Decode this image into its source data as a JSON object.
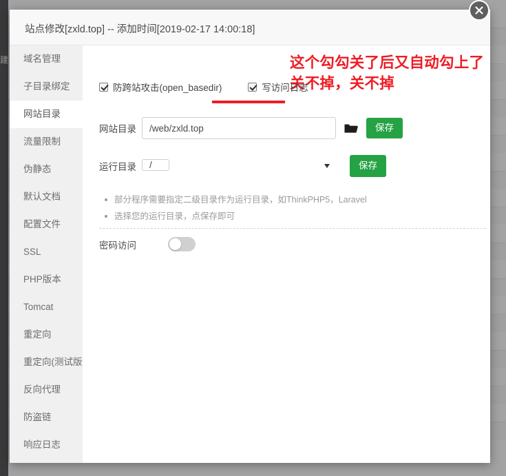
{
  "background": {
    "rail_label": "建"
  },
  "modal": {
    "title": "站点修改[zxld.top] -- 添加时间[2019-02-17 14:00:18]",
    "close_label": "×"
  },
  "sidenav": {
    "items": [
      {
        "label": "域名管理",
        "active": false
      },
      {
        "label": "子目录绑定",
        "active": false
      },
      {
        "label": "网站目录",
        "active": true
      },
      {
        "label": "流量限制",
        "active": false
      },
      {
        "label": "伪静态",
        "active": false
      },
      {
        "label": "默认文档",
        "active": false
      },
      {
        "label": "配置文件",
        "active": false
      },
      {
        "label": "SSL",
        "active": false
      },
      {
        "label": "PHP版本",
        "active": false
      },
      {
        "label": "Tomcat",
        "active": false
      },
      {
        "label": "重定向",
        "active": false
      },
      {
        "label": "重定向(测试版)",
        "active": false
      },
      {
        "label": "反向代理",
        "active": false
      },
      {
        "label": "防盗链",
        "active": false
      },
      {
        "label": "响应日志",
        "active": false
      }
    ]
  },
  "body": {
    "checkboxes": [
      {
        "label": "防跨站攻击(open_basedir)",
        "checked": true
      },
      {
        "label": "写访问日志",
        "checked": true
      }
    ],
    "annotation": {
      "line1": "这个勾勾关了后又自动勾上了",
      "line2": "关不掉，关不掉",
      "color": "#ee1c25"
    },
    "site_dir": {
      "label": "网站目录",
      "value": "/web/zxld.top",
      "placeholder": "",
      "browse_icon": "folder-icon",
      "save_label": "保存"
    },
    "run_dir": {
      "label": "运行目录",
      "value": "/",
      "options": [
        "/"
      ],
      "save_label": "保存"
    },
    "hints": [
      "部分程序需要指定二级目录作为运行目录，如ThinkPHP5，Laravel",
      "选择您的运行目录，点保存即可"
    ],
    "password_access": {
      "label": "密码访问",
      "enabled": false
    },
    "accent_color": "#25a244"
  }
}
